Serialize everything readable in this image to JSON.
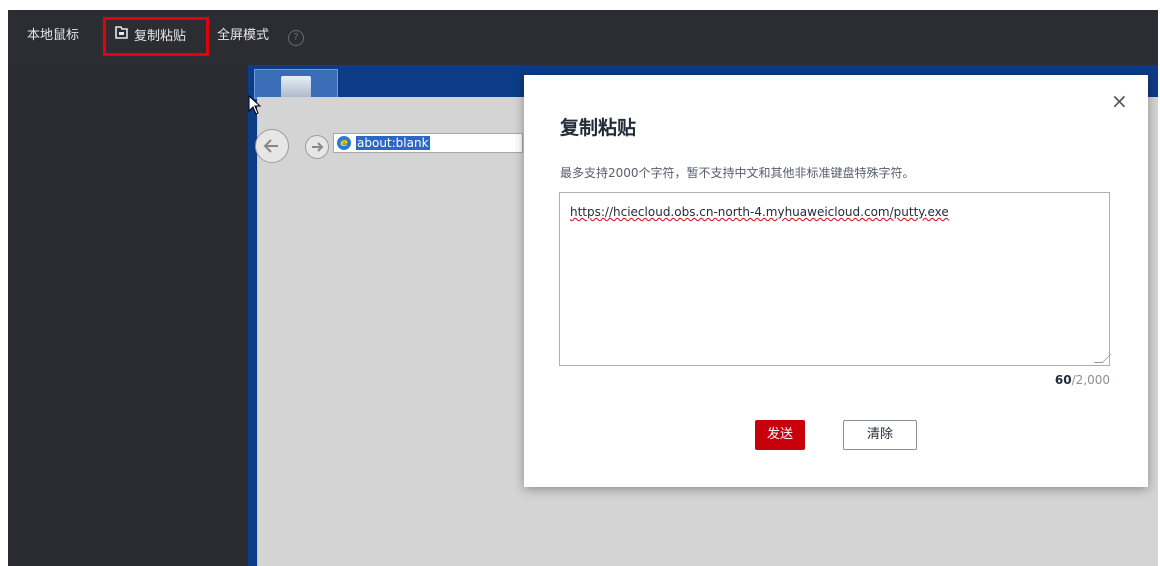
{
  "toolbar": {
    "local_mouse": "本地鼠标",
    "copy_paste": "复制粘贴",
    "fullscreen": "全屏模式",
    "help": "?"
  },
  "remote": {
    "address": "about:blank",
    "ie_glyph": "e"
  },
  "dialog": {
    "title": "复制粘贴",
    "close": "×",
    "hint": "最多支持2000个字符，暂不支持中文和其他非标准键盘特殊字符。",
    "textarea_value": "https://hciecloud.obs.cn-north-4.myhuaweicloud.com/putty.exe",
    "count_current": "60",
    "count_max": "/2,000",
    "send_label": "发送",
    "clear_label": "清除"
  }
}
